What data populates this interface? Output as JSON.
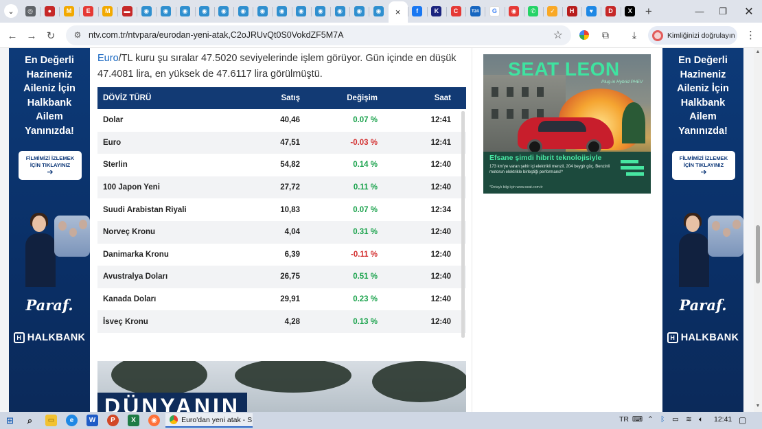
{
  "browser": {
    "tab_favicons": [
      {
        "icon": "tab-site-icon",
        "color": "#5f6368",
        "glyph": "◎"
      },
      {
        "icon": "tab-site-icon",
        "color": "#c62828",
        "glyph": "●"
      },
      {
        "icon": "tab-site-icon",
        "color": "#f2a900",
        "glyph": "M"
      },
      {
        "icon": "tab-site-icon",
        "color": "#e53935",
        "glyph": "E"
      },
      {
        "icon": "tab-site-icon",
        "color": "#f2a900",
        "glyph": "M"
      },
      {
        "icon": "tab-site-icon",
        "color": "#c62828",
        "glyph": "▬"
      },
      {
        "icon": "tab-site-icon",
        "color": "#2f8fcf",
        "glyph": "◉"
      },
      {
        "icon": "tab-site-icon",
        "color": "#2f8fcf",
        "glyph": "◉"
      },
      {
        "icon": "tab-site-icon",
        "color": "#2f8fcf",
        "glyph": "◉"
      },
      {
        "icon": "tab-site-icon",
        "color": "#2f8fcf",
        "glyph": "◉"
      },
      {
        "icon": "tab-site-icon",
        "color": "#2f8fcf",
        "glyph": "◉"
      },
      {
        "icon": "tab-site-icon",
        "color": "#2f8fcf",
        "glyph": "◉"
      },
      {
        "icon": "tab-site-icon",
        "color": "#2f8fcf",
        "glyph": "◉"
      },
      {
        "icon": "tab-site-icon",
        "color": "#2f8fcf",
        "glyph": "◉"
      },
      {
        "icon": "tab-site-icon",
        "color": "#2f8fcf",
        "glyph": "◉"
      },
      {
        "icon": "tab-site-icon",
        "color": "#2f8fcf",
        "glyph": "◉"
      },
      {
        "icon": "tab-site-icon",
        "color": "#2f8fcf",
        "glyph": "◉"
      },
      {
        "icon": "tab-site-icon",
        "color": "#2f8fcf",
        "glyph": "◉"
      },
      {
        "icon": "tab-site-icon",
        "color": "#2f8fcf",
        "glyph": "◉"
      }
    ],
    "active_tab_close": "×",
    "tab_favicons_after": [
      {
        "icon": "facebook-icon",
        "color": "#1877f2",
        "glyph": "f"
      },
      {
        "icon": "tab-site-icon",
        "color": "#1a237e",
        "glyph": "K"
      },
      {
        "icon": "tab-site-icon",
        "color": "#e53935",
        "glyph": "C"
      },
      {
        "icon": "tab-site-icon",
        "color": "#1565c0",
        "glyph": "T24"
      },
      {
        "icon": "google-icon",
        "color": "#ffffff",
        "glyph": "G"
      },
      {
        "icon": "tab-site-icon",
        "color": "#e53935",
        "glyph": "◉"
      },
      {
        "icon": "whatsapp-icon",
        "color": "#25d366",
        "glyph": "✆"
      },
      {
        "icon": "tab-site-icon",
        "color": "#f9a825",
        "glyph": "✓"
      },
      {
        "icon": "tab-site-icon",
        "color": "#b71c1c",
        "glyph": "H"
      },
      {
        "icon": "tab-site-icon",
        "color": "#1e88e5",
        "glyph": "♥"
      },
      {
        "icon": "tab-site-icon",
        "color": "#c62828",
        "glyph": "D"
      },
      {
        "icon": "x-icon",
        "color": "#000000",
        "glyph": "X"
      }
    ],
    "new_tab": "+",
    "url": "ntv.com.tr/ntvpara/eurodan-yeni-atak,C2oJRUvQt0S0VokdZF5M7A",
    "profile_label": "Kimliğinizi doğrulayın"
  },
  "page": {
    "intro_link": "Euro",
    "intro_rest": "/TL kuru şu sıralar 47.5020 seviyelerinde işlem görüyor. Gün içinde en düşük 47.4081 lira, en yüksek de 47.6117 lira görülmüştü.",
    "table": {
      "headers": {
        "name": "DÖVİZ TÜRÜ",
        "sell": "Satış",
        "change": "Değişim",
        "time": "Saat"
      },
      "rows": [
        {
          "name": "Dolar",
          "sell": "40,46",
          "change": "0.07 %",
          "time": "12:41",
          "trend": "up"
        },
        {
          "name": "Euro",
          "sell": "47,51",
          "change": "-0.03 %",
          "time": "12:41",
          "trend": "down"
        },
        {
          "name": "Sterlin",
          "sell": "54,82",
          "change": "0.14 %",
          "time": "12:40",
          "trend": "up"
        },
        {
          "name": "100 Japon Yeni",
          "sell": "27,72",
          "change": "0.11 %",
          "time": "12:40",
          "trend": "up"
        },
        {
          "name": "Suudi Arabistan Riyali",
          "sell": "10,83",
          "change": "0.07 %",
          "time": "12:34",
          "trend": "up"
        },
        {
          "name": "Norveç Kronu",
          "sell": "4,04",
          "change": "0.31 %",
          "time": "12:40",
          "trend": "up"
        },
        {
          "name": "Danimarka Kronu",
          "sell": "6,39",
          "change": "-0.11 %",
          "time": "12:40",
          "trend": "down"
        },
        {
          "name": "Avustralya Doları",
          "sell": "26,75",
          "change": "0.51 %",
          "time": "12:40",
          "trend": "up"
        },
        {
          "name": "Kanada Doları",
          "sell": "29,91",
          "change": "0.23 %",
          "time": "12:40",
          "trend": "up"
        },
        {
          "name": "İsveç Kronu",
          "sell": "4,28",
          "change": "0.13 %",
          "time": "12:40",
          "trend": "up"
        }
      ]
    },
    "photo_headline": "DÜNYANIN"
  },
  "side_ad": {
    "headline_lines": [
      "En Değerli",
      "Hazineniz",
      "Aileniz İçin",
      "Halkbank",
      "Ailem",
      "Yanınızda!"
    ],
    "cta_line1": "FİLMİMİZİ İZLEMEK",
    "cta_line2": "İÇİN TIKLAYINIZ",
    "cta_arrow": "➔",
    "paraf": "Paraf.",
    "bank": "HALKBANK"
  },
  "seat_ad": {
    "title": "SEAT LEON",
    "subtitle": "Plug-in Hybrid PHEV",
    "tagline": "Efsane şimdi hibrit teknolojisiyle",
    "description": "173 km'ye varan şehir içi elektrikli menzil, 204 beygir güç. Benzinli motorun elektrikle birleştiği performans!*",
    "disclaimer": "*Detaylı bilgi için www.seat.com.tr"
  },
  "taskbar": {
    "app_title": "Euro'dan yeni atak - S...",
    "lang": "TR",
    "clock": "12:41"
  },
  "colors": {
    "table_header": "#123a74",
    "positive": "#19a24b",
    "negative": "#d32f2f",
    "link": "#1565c0",
    "halkbank_blue": "#0d3a78",
    "seat_green": "#3fe3a0"
  }
}
